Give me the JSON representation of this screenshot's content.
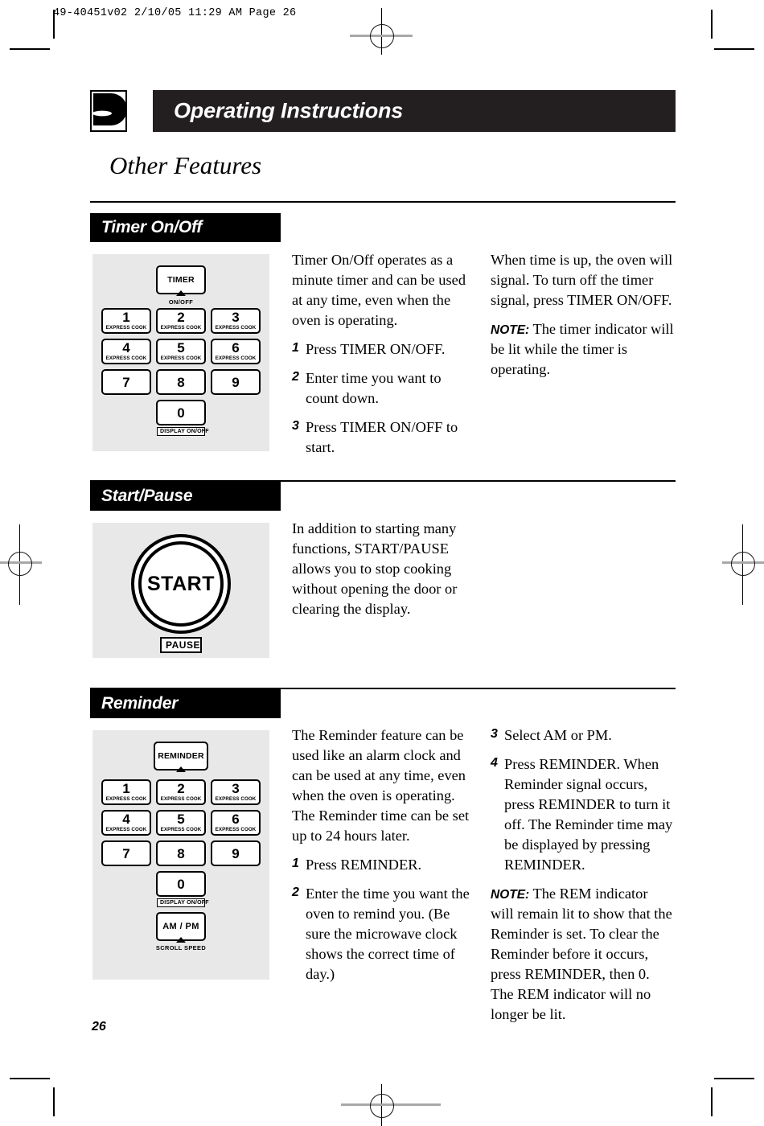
{
  "printer": {
    "slug": "49-40451v02  2/10/05  11:29 AM  Page 26"
  },
  "header": {
    "icon_name": "knob-dial-icon",
    "title": "Operating Instructions"
  },
  "page_subtitle": "Other Features",
  "page_number": "26",
  "colors": {
    "header_bar": "#231f20",
    "section_tab": "#000000",
    "panel": "#e8e8e8",
    "text": "#000000"
  },
  "keypad": {
    "digits": [
      {
        "digit": "1",
        "sub": "EXPRESS COOK"
      },
      {
        "digit": "2",
        "sub": "EXPRESS COOK"
      },
      {
        "digit": "3",
        "sub": "EXPRESS COOK"
      },
      {
        "digit": "4",
        "sub": "EXPRESS COOK"
      },
      {
        "digit": "5",
        "sub": "EXPRESS COOK"
      },
      {
        "digit": "6",
        "sub": "EXPRESS COOK"
      },
      {
        "digit": "7",
        "sub": ""
      },
      {
        "digit": "8",
        "sub": ""
      },
      {
        "digit": "9",
        "sub": ""
      }
    ],
    "zero": "0",
    "zero_caption": "DISPLAY ON/OFF",
    "timer_key": "TIMER",
    "timer_caption": "ON/OFF",
    "reminder_key": "REMINDER",
    "ampm_key": "AM / PM",
    "ampm_caption": "SCROLL SPEED"
  },
  "sections": [
    {
      "id": "timer",
      "tab_label": "Timer On/Off",
      "col1": {
        "intro": "Timer On/Off operates as a minute timer and can be used at any time, even when the oven is operating.",
        "steps": [
          {
            "num": "1",
            "text": "Press TIMER ON/OFF."
          },
          {
            "num": "2",
            "text": "Enter time you want to count down."
          },
          {
            "num": "3",
            "text": "Press TIMER ON/OFF to start."
          }
        ]
      },
      "col2": {
        "intro": "When time is up, the oven will signal. To turn off the timer signal, press TIMER ON/OFF.",
        "note_label": "NOTE:",
        "note_text": " The timer indicator will be lit while the timer is operating."
      }
    },
    {
      "id": "start-pause",
      "tab_label": "Start/Pause",
      "start_label": "START",
      "pause_label": "PAUSE",
      "col1": {
        "intro": "In addition to starting many functions, START/PAUSE allows you to stop cooking without opening the door or clearing the display."
      }
    },
    {
      "id": "reminder",
      "tab_label": "Reminder",
      "col1": {
        "intro": "The Reminder feature can be used like an alarm clock and can be used at any time, even when the oven is operating. The Reminder time can be set up to 24 hours later.",
        "steps": [
          {
            "num": "1",
            "text": "Press REMINDER."
          },
          {
            "num": "2",
            "text": "Enter the time you want the oven to remind you. (Be sure the microwave clock shows the correct time of day.)"
          }
        ]
      },
      "col2": {
        "steps": [
          {
            "num": "3",
            "text": "Select AM or PM."
          },
          {
            "num": "4",
            "text": "Press REMINDER. When Reminder signal occurs, press REMINDER to turn it off. The Reminder time may be displayed by pressing REMINDER."
          }
        ],
        "note_label": "NOTE:",
        "note_text": " The REM indicator will remain lit to show that the Reminder is set. To clear the Reminder before it occurs, press REMINDER, then 0. The REM indicator will no longer be lit."
      }
    }
  ]
}
